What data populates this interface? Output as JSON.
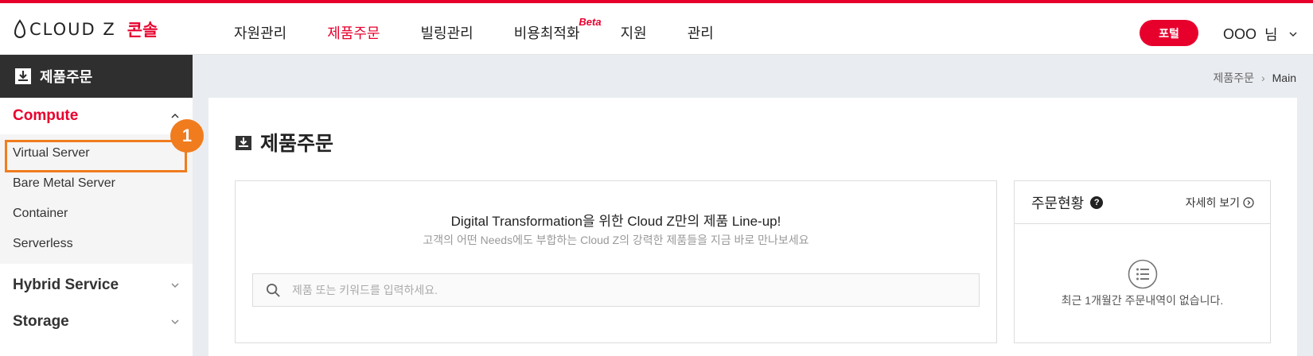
{
  "header": {
    "brand": "CLOUD Z",
    "console": "콘솔",
    "nav": [
      {
        "label": "자원관리",
        "active": false
      },
      {
        "label": "제품주문",
        "active": true
      },
      {
        "label": "빌링관리",
        "active": false
      },
      {
        "label": "비용최적화",
        "active": false,
        "badge": "Beta"
      },
      {
        "label": "지원",
        "active": false
      },
      {
        "label": "관리",
        "active": false
      }
    ],
    "portal_label": "포털",
    "user_name": "OOO",
    "user_suffix": "님",
    "accent_color": "#e8002d"
  },
  "sidebar": {
    "title": "제품주문",
    "categories": [
      {
        "label": "Compute",
        "expanded": true,
        "items": [
          "Virtual Server",
          "Bare Metal Server",
          "Container",
          "Serverless"
        ]
      },
      {
        "label": "Hybrid Service",
        "expanded": false
      },
      {
        "label": "Storage",
        "expanded": false
      }
    ],
    "step_badge": "1",
    "highlight_color": "#f07c1e"
  },
  "breadcrumb": {
    "parent": "제품주문",
    "current": "Main"
  },
  "main": {
    "title": "제품주문",
    "promo_title": "Digital Transformation을 위한 Cloud Z만의 제품 Line-up!",
    "promo_subtitle": "고객의 어떤 Needs에도 부합하는 Cloud Z의 강력한 제품들을 지금 바로 만나보세요",
    "search_placeholder": "제품 또는 키워드를 입력하세요."
  },
  "order_status": {
    "title": "주문현황",
    "more_label": "자세히 보기",
    "empty_message": "최근 1개월간 주문내역이 없습니다."
  }
}
